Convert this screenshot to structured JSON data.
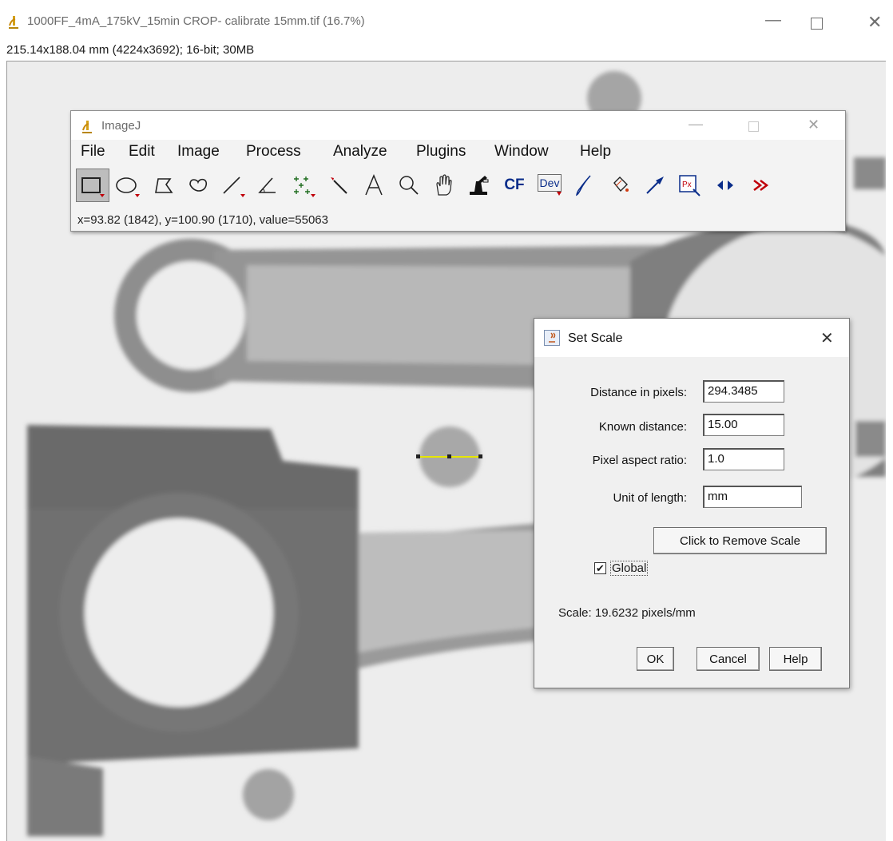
{
  "window": {
    "title": "1000FF_4mA_175kV_15min CROP- calibrate 15mm.tif (16.7%)",
    "subtitle": "215.14x188.04 mm (4224x3692); 16-bit; 30MB",
    "icon": "imagej-microscope-icon"
  },
  "toolbar_window": {
    "title": "ImageJ",
    "menus": [
      "File",
      "Edit",
      "Image",
      "Process",
      "Analyze",
      "Plugins",
      "Window",
      "Help"
    ],
    "tools": [
      "rectangle-tool",
      "oval-tool",
      "polygon-tool",
      "freehand-tool",
      "line-tool",
      "angle-tool",
      "multipoint-tool",
      "wand-tool",
      "text-tool",
      "magnifier-tool",
      "scroll-tool",
      "color-picker-tool",
      "cf-tool",
      "dev-tool",
      "brush-tool",
      "flood-fill-tool",
      "arrow-tool",
      "pixel-inspector-tool",
      "stack-swapper-tool",
      "more-tools"
    ],
    "cf_label": "CF",
    "dev_label": "Dev",
    "px_label": "Px",
    "status": "x=93.82 (1842), y=100.90 (1710), value=55063"
  },
  "dialog": {
    "title": "Set Scale",
    "fields": [
      {
        "label": "Distance in pixels:",
        "value": "294.3485"
      },
      {
        "label": "Known distance:",
        "value": "15.00"
      },
      {
        "label": "Pixel aspect ratio:",
        "value": "1.0"
      },
      {
        "label": "Unit of length:",
        "value": "mm"
      }
    ],
    "remove_scale_label": "Click to Remove Scale",
    "global_label": "Global",
    "global_checked": true,
    "scale_text": "Scale: 19.6232 pixels/mm",
    "ok_label": "OK",
    "cancel_label": "Cancel",
    "help_label": "Help"
  },
  "colors": {
    "background": "#ededed",
    "part_gray": "#7a7a7a",
    "line_selection": "#e6e600",
    "accent_red": "#c0000a"
  }
}
